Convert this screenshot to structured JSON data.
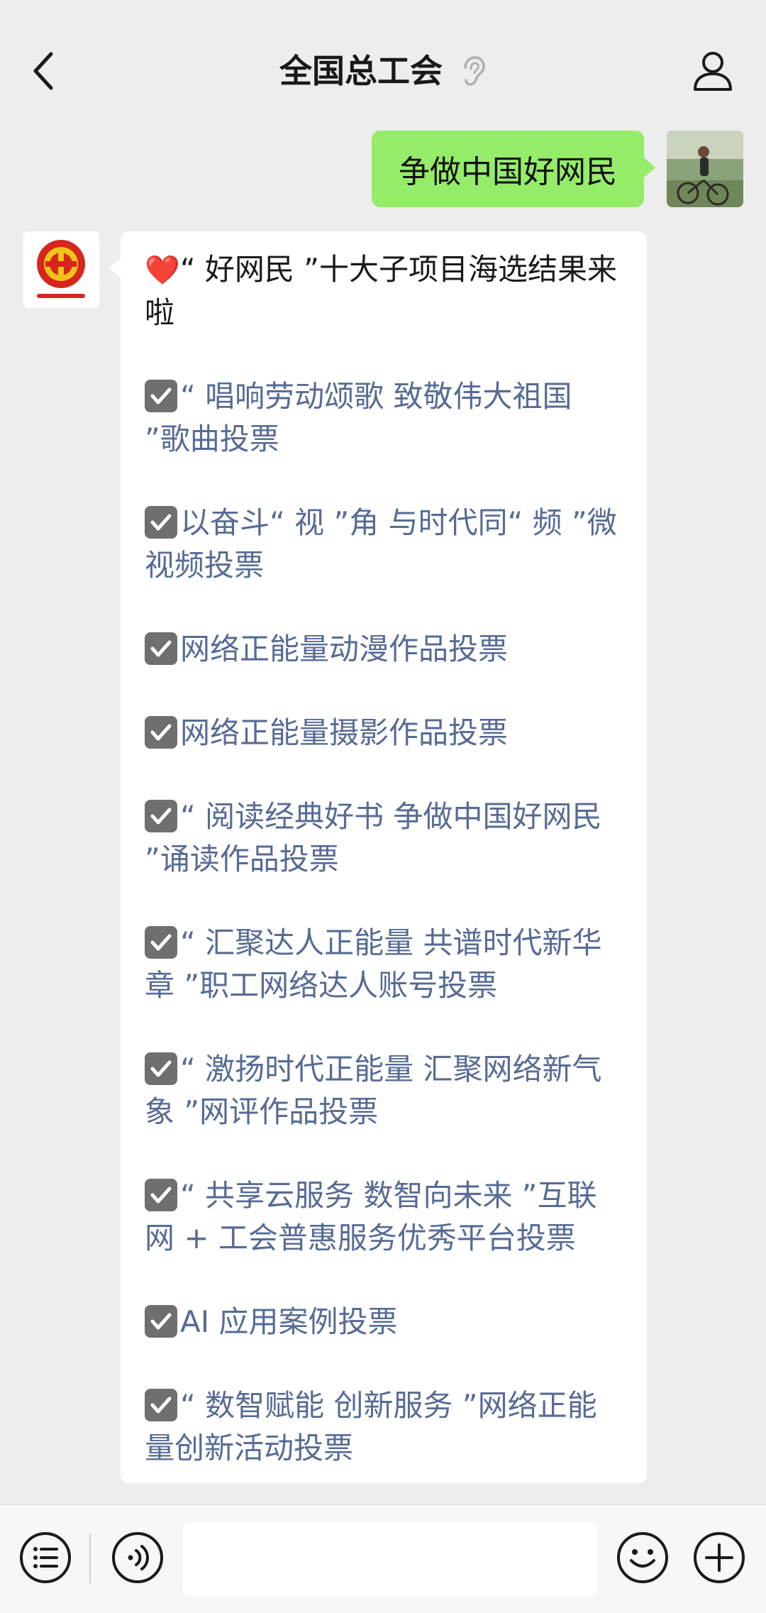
{
  "header": {
    "title": "全国总工会"
  },
  "sent_message": {
    "text": "争做中国好网民"
  },
  "received_message": {
    "headline": "“ 好网民 ”十大子项目海选结果来啦",
    "items": [
      "“ 唱响劳动颂歌 致敬伟大祖国 ”歌曲投票",
      "以奋斗“ 视 ”角 与时代同“ 频 ”微视频投票",
      "网络正能量动漫作品投票",
      "网络正能量摄影作品投票",
      "“ 阅读经典好书 争做中国好网民 ”诵读作品投票",
      "“ 汇聚达人正能量 共谱时代新华章 ”职工网络达人账号投票",
      "“ 激扬时代正能量 汇聚网络新气象 ”网评作品投票",
      "“ 共享云服务 数智向未来 ”互联网 + 工会普惠服务优秀平台投票",
      "AI 应用案例投票",
      "“ 数智赋能 创新服务 ”网络正能量创新活动投票"
    ]
  },
  "input_bar": {
    "value": ""
  },
  "icons": {
    "back": "chevron-left-icon",
    "mute": "ear-icon",
    "profile": "person-icon",
    "menu": "list-menu-icon",
    "voice": "voice-icon",
    "emoji": "smiley-icon",
    "more": "plus-icon"
  },
  "colors": {
    "background": "#ededed",
    "sent_bubble": "#95ec69",
    "received_bubble": "#ffffff",
    "link_text": "#576b95",
    "heart": "#e0242b",
    "logo_red": "#d7261e",
    "logo_gold": "#f0c419"
  }
}
